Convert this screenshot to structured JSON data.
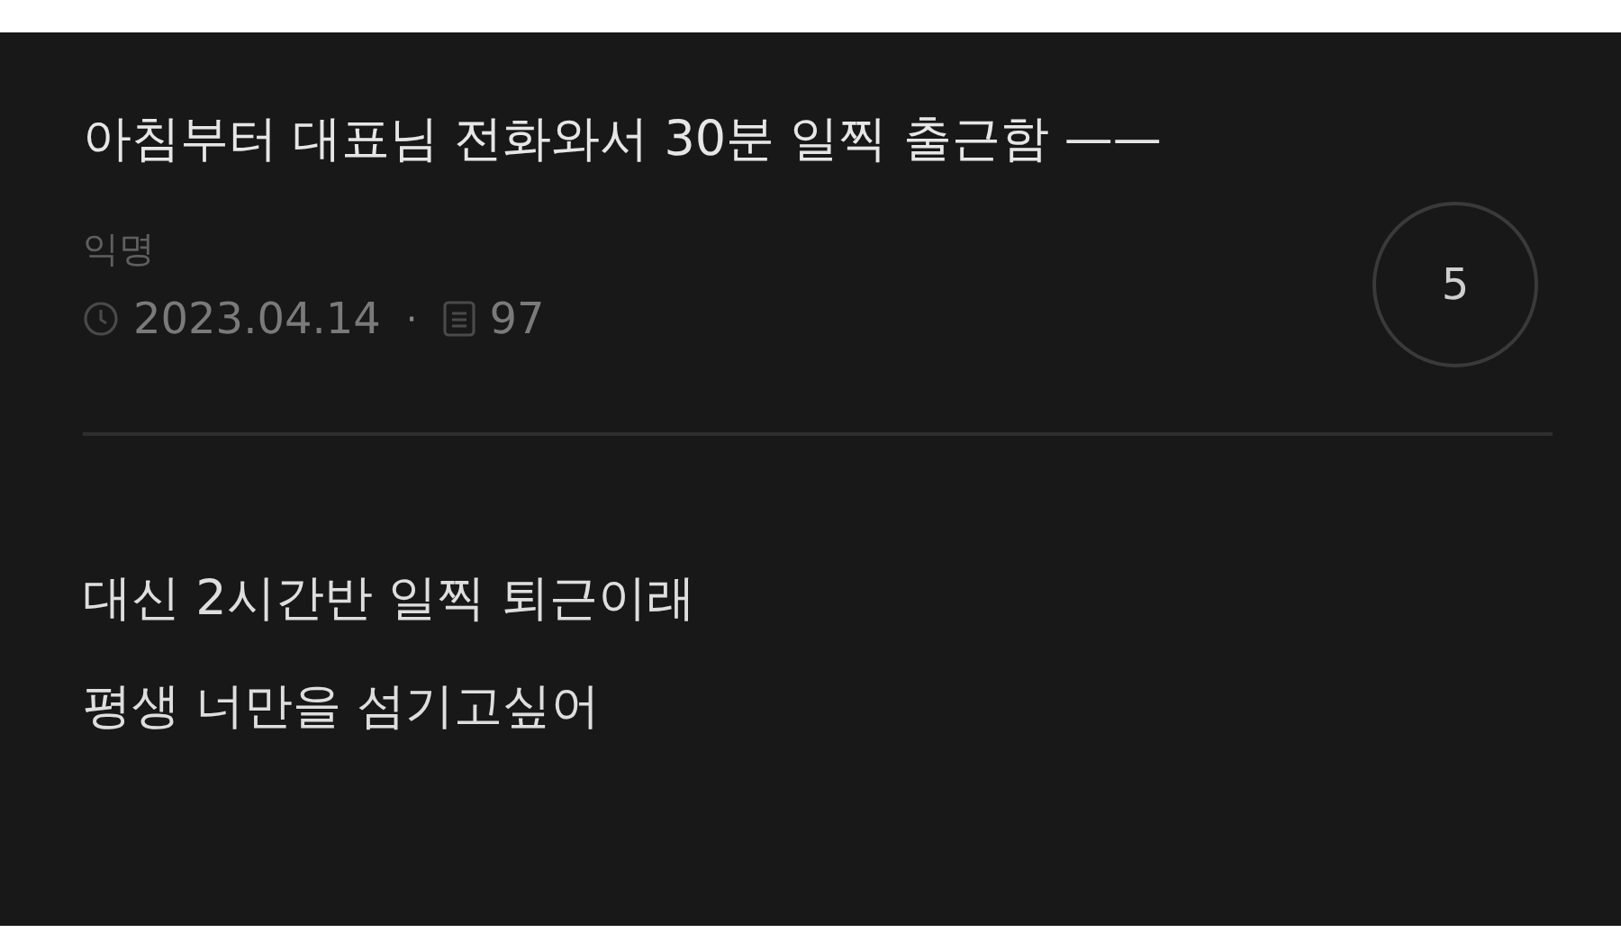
{
  "post": {
    "title": "아침부터 대표님 전화와서 30분 일찍 출근함 ——",
    "author": "익명",
    "date": "2023.04.14",
    "separator": "·",
    "views": "97",
    "comment_count": "5"
  },
  "body": [
    "대신 2시간반 일찍 퇴근이래",
    "평생 너만을 섬기고싶어"
  ]
}
